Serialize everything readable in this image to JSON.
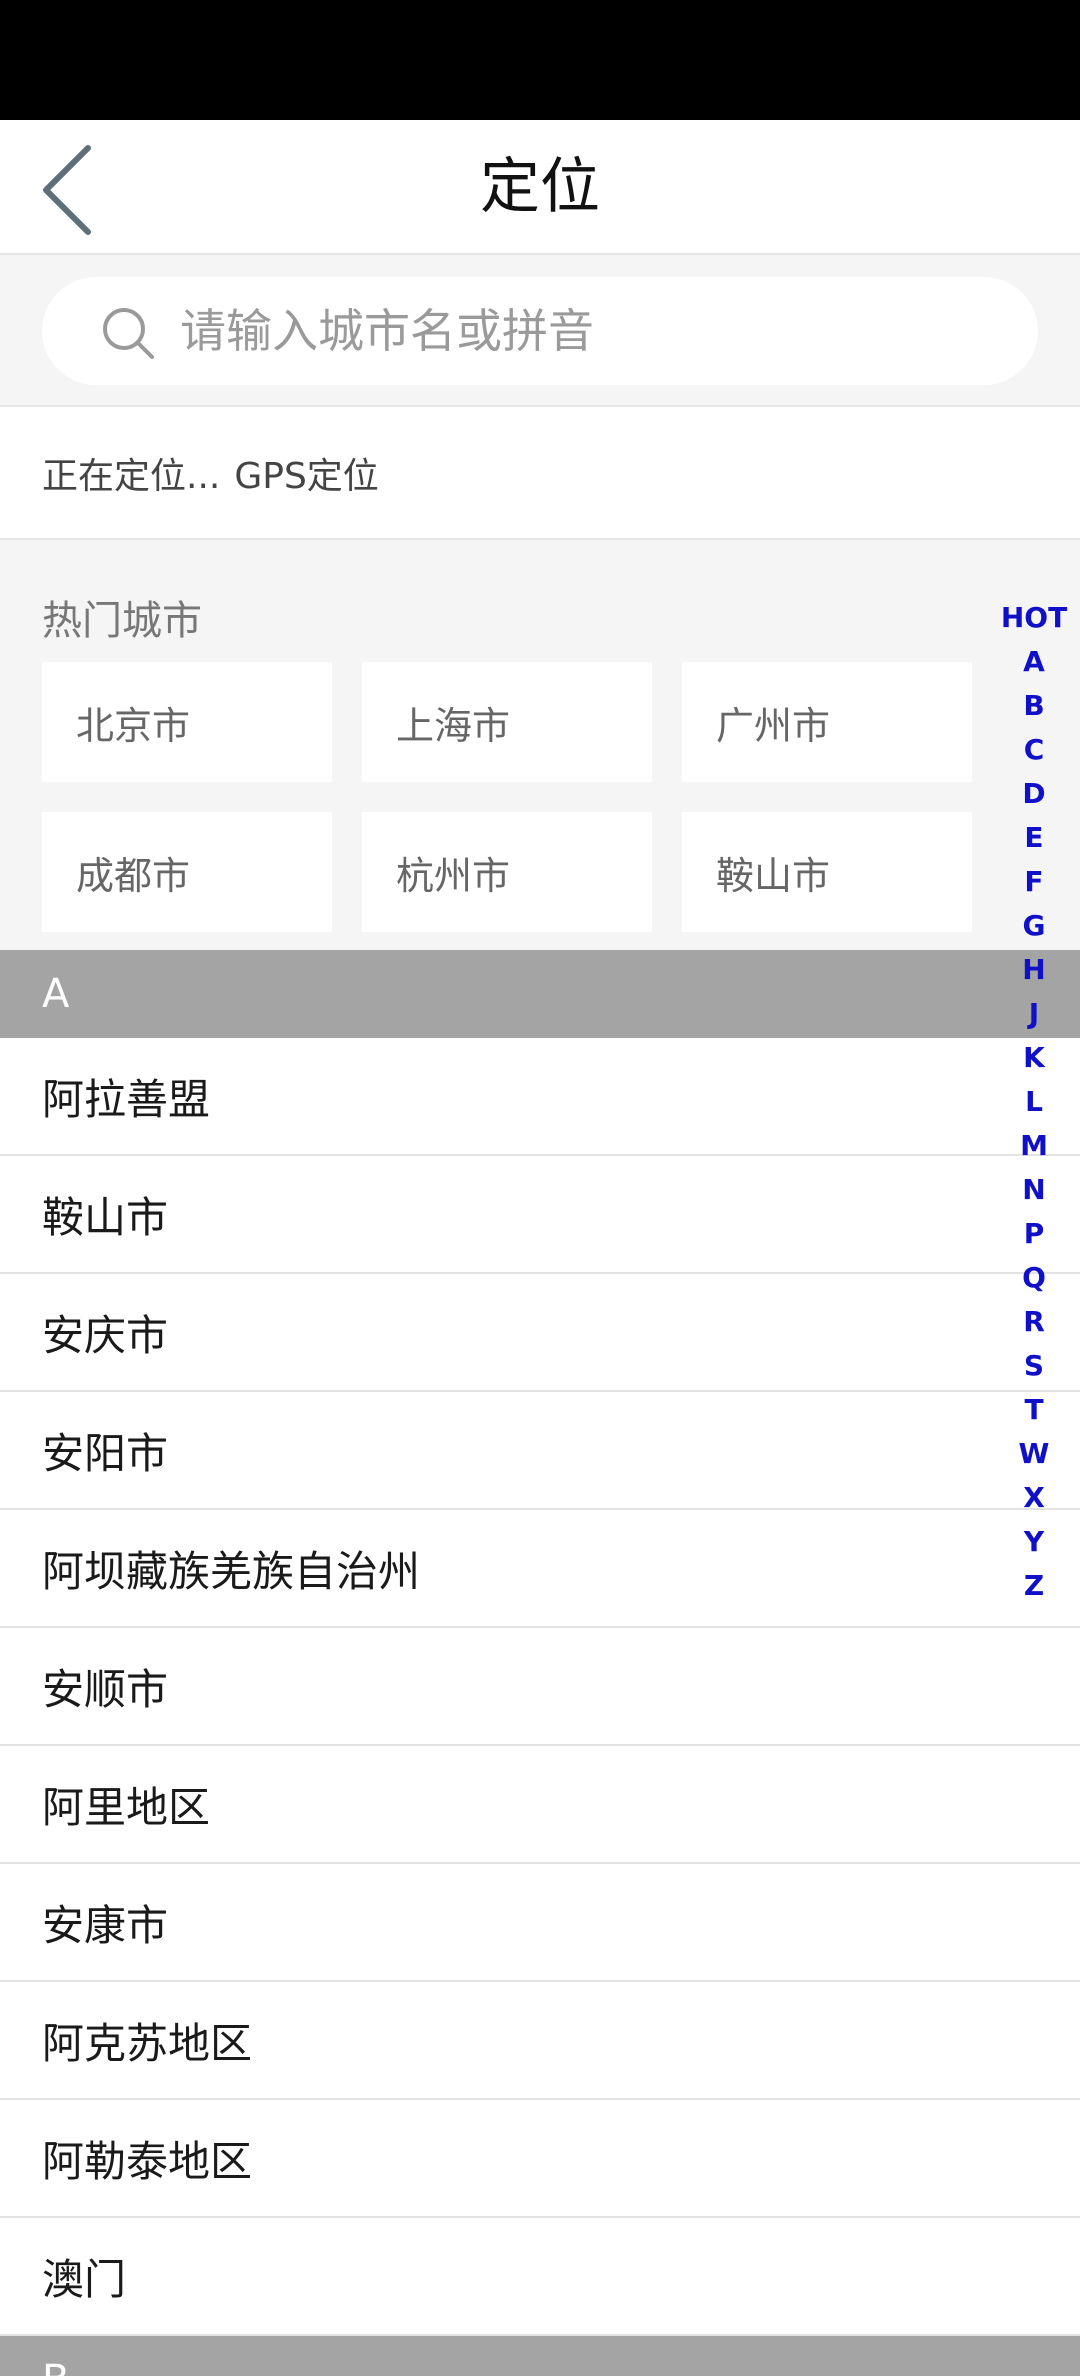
{
  "nav": {
    "title": "定位",
    "back_icon": "chevron-left-icon"
  },
  "search": {
    "placeholder": "请输入城市名或拼音",
    "value": "",
    "icon": "search-icon"
  },
  "location": {
    "status": "正在定位...",
    "type": "GPS定位"
  },
  "hot": {
    "title": "热门城市",
    "cities": [
      "北京市",
      "上海市",
      "广州市",
      "成都市",
      "杭州市",
      "鞍山市"
    ]
  },
  "list": {
    "sections": [
      {
        "letter": "A",
        "cities": [
          "阿拉善盟",
          "鞍山市",
          "安庆市",
          "安阳市",
          "阿坝藏族羌族自治州",
          "安顺市",
          "阿里地区",
          "安康市",
          "阿克苏地区",
          "阿勒泰地区",
          "澳门"
        ]
      },
      {
        "letter": "B",
        "cities": []
      }
    ]
  },
  "index": [
    "HOT",
    "A",
    "B",
    "C",
    "D",
    "E",
    "F",
    "G",
    "H",
    "J",
    "K",
    "L",
    "M",
    "N",
    "P",
    "Q",
    "R",
    "S",
    "T",
    "W",
    "X",
    "Y",
    "Z"
  ],
  "colors": {
    "index_text": "#1010c8",
    "section_header_bg": "#a4a4a4",
    "page_bg_gray": "#f5f5f5"
  }
}
